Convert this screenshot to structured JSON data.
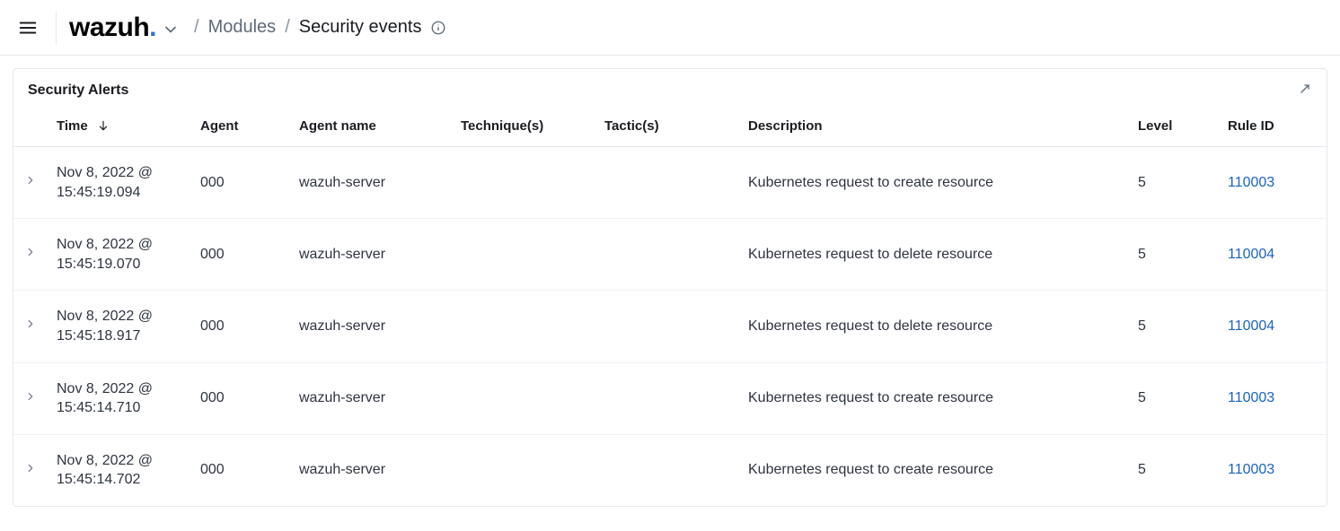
{
  "header": {
    "brand_text": "wazuh",
    "brand_dot": ".",
    "breadcrumb_modules": "Modules",
    "breadcrumb_current": "Security events"
  },
  "panel": {
    "title": "Security Alerts"
  },
  "table": {
    "columns": {
      "time": "Time",
      "agent": "Agent",
      "agent_name": "Agent name",
      "technique": "Technique(s)",
      "tactic": "Tactic(s)",
      "description": "Description",
      "level": "Level",
      "rule_id": "Rule ID"
    },
    "rows": [
      {
        "time_line1": "Nov 8, 2022 @",
        "time_line2": "15:45:19.094",
        "agent": "000",
        "agent_name": "wazuh-server",
        "technique": "",
        "tactic": "",
        "description": "Kubernetes request to create resource",
        "level": "5",
        "rule_id": "110003"
      },
      {
        "time_line1": "Nov 8, 2022 @",
        "time_line2": "15:45:19.070",
        "agent": "000",
        "agent_name": "wazuh-server",
        "technique": "",
        "tactic": "",
        "description": "Kubernetes request to delete resource",
        "level": "5",
        "rule_id": "110004"
      },
      {
        "time_line1": "Nov 8, 2022 @",
        "time_line2": "15:45:18.917",
        "agent": "000",
        "agent_name": "wazuh-server",
        "technique": "",
        "tactic": "",
        "description": "Kubernetes request to delete resource",
        "level": "5",
        "rule_id": "110004"
      },
      {
        "time_line1": "Nov 8, 2022 @",
        "time_line2": "15:45:14.710",
        "agent": "000",
        "agent_name": "wazuh-server",
        "technique": "",
        "tactic": "",
        "description": "Kubernetes request to create resource",
        "level": "5",
        "rule_id": "110003"
      },
      {
        "time_line1": "Nov 8, 2022 @",
        "time_line2": "15:45:14.702",
        "agent": "000",
        "agent_name": "wazuh-server",
        "technique": "",
        "tactic": "",
        "description": "Kubernetes request to create resource",
        "level": "5",
        "rule_id": "110003"
      }
    ]
  }
}
